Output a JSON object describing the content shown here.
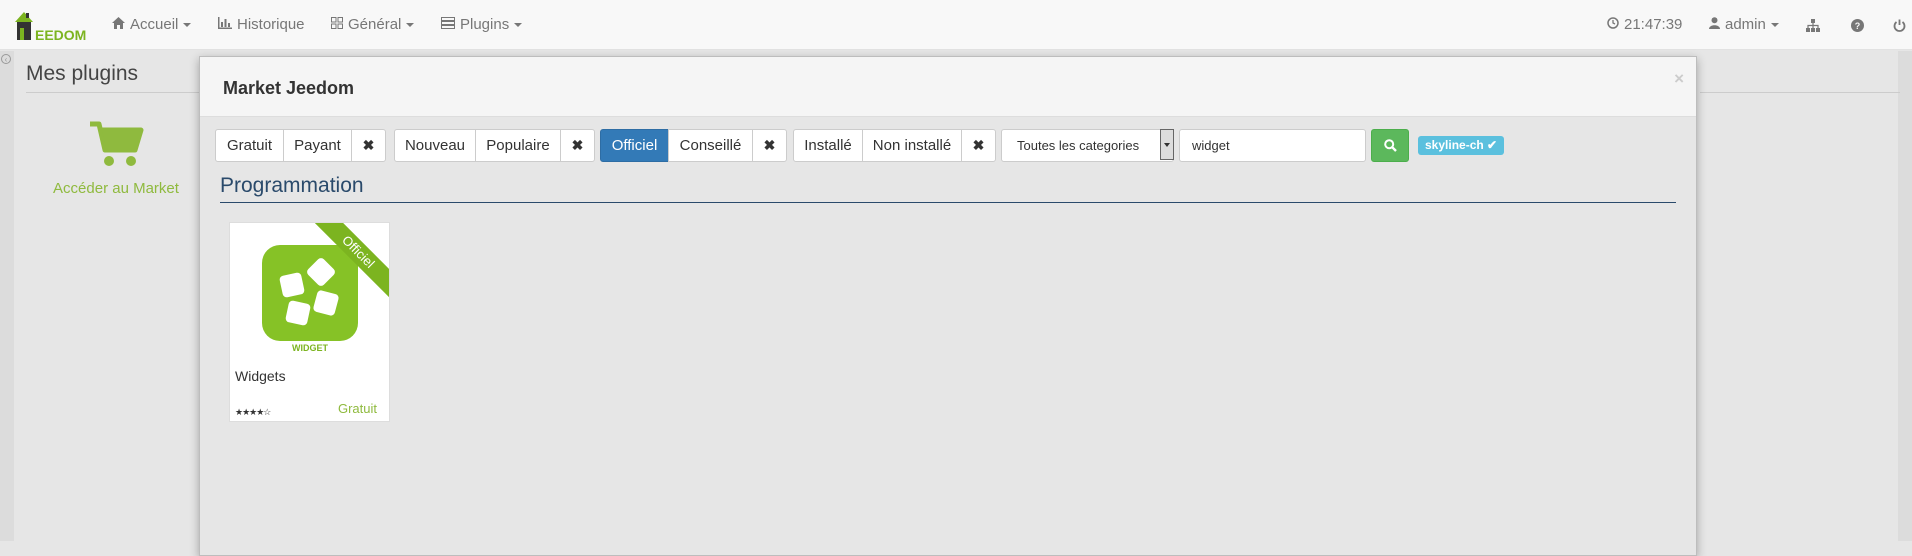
{
  "navbar": {
    "brand": "EEDOM",
    "items": [
      {
        "label": "Accueil",
        "icon": "home-icon"
      },
      {
        "label": "Historique",
        "icon": "bar-chart-icon"
      },
      {
        "label": "Général",
        "icon": "grid-icon"
      },
      {
        "label": "Plugins",
        "icon": "tasks-icon"
      }
    ],
    "clock": "21:47:39",
    "user": "admin"
  },
  "page": {
    "title": "Mes plugins",
    "market_link": "Accéder au Market"
  },
  "modal": {
    "title": "Market Jeedom",
    "close": "×",
    "filters": {
      "price": [
        "Gratuit",
        "Payant"
      ],
      "popularity": [
        "Nouveau",
        "Populaire"
      ],
      "certification": [
        "Officiel",
        "Conseillé"
      ],
      "certification_active": "Officiel",
      "install": [
        "Installé",
        "Non installé"
      ],
      "reset_glyph": "✖"
    },
    "category_select": "Toutes les categories",
    "search_value": "widget",
    "user_badge": "skyline-ch ✔",
    "section_title": "Programmation",
    "plugin": {
      "ribbon": "Officiel",
      "logo_text": "WIDGET",
      "name": "Widgets",
      "rating": "★★★★☆",
      "price": "Gratuit"
    }
  },
  "colors": {
    "accent_green": "#7cb420",
    "active_blue": "#337ab7",
    "success_green": "#5cb85c",
    "info_blue": "#5bc0de"
  }
}
